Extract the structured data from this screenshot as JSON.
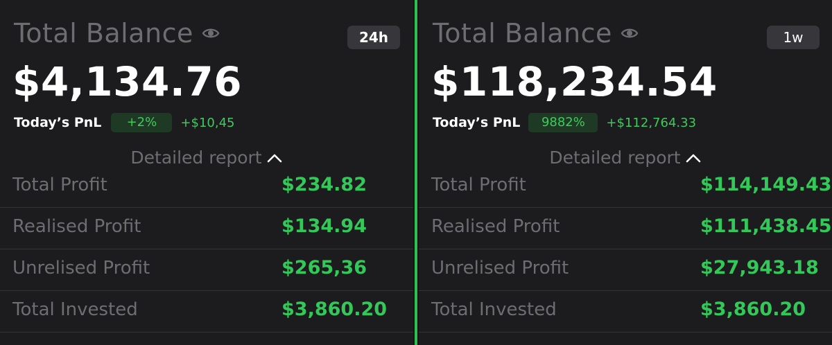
{
  "panels": [
    {
      "title": "Total Balance",
      "period": "24h",
      "balance": "$4,134.76",
      "pnl_label": "Today’s PnL",
      "pnl_percent": "+2%",
      "pnl_amount": "+$10,45",
      "report_label": "Detailed report",
      "rows": [
        {
          "label": "Total Profit",
          "value": "$234.82"
        },
        {
          "label": "Realised Profit",
          "value": "$134.94"
        },
        {
          "label": "Unrelised Profit",
          "value": "$265,36"
        },
        {
          "label": "Total Invested",
          "value": "$3,860.20"
        }
      ]
    },
    {
      "title": "Total Balance",
      "period": "1w",
      "balance": "$118,234.54",
      "pnl_label": "Today’s PnL",
      "pnl_percent": "9882%",
      "pnl_amount": "+$112,764.33",
      "report_label": "Detailed report",
      "rows": [
        {
          "label": "Total Profit",
          "value": "$114,149.43"
        },
        {
          "label": "Realised Profit",
          "value": "$111,438.45"
        },
        {
          "label": "Unrelised Profit",
          "value": "$27,943.18"
        },
        {
          "label": "Total Invested",
          "value": "$3,860.20"
        }
      ]
    }
  ],
  "icons": {
    "visibility": "eye-icon",
    "collapse": "chevron-up-icon"
  },
  "colors": {
    "accent_green": "#34c759",
    "divider": "#2fc14e",
    "background": "#1c1c1e"
  }
}
